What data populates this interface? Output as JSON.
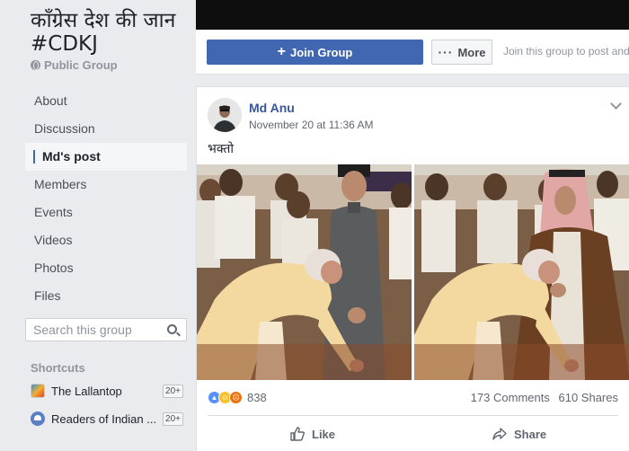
{
  "sidebar": {
    "group_name": "कॉंग्रेस देश की जान #CDKJ",
    "privacy": "Public Group",
    "nav": [
      "About",
      "Discussion",
      "Md's post",
      "Members",
      "Events",
      "Videos",
      "Photos",
      "Files"
    ],
    "active_nav": "Md's post",
    "search_placeholder": "Search this group",
    "shortcuts_title": "Shortcuts",
    "shortcuts": [
      {
        "label": "The Lallantop",
        "badge": "20+",
        "icon": "lallantop-avatar-icon"
      },
      {
        "label": "Readers of Indian ...",
        "badge": "20+",
        "icon": "group-people-icon"
      }
    ]
  },
  "header": {
    "join_label": "Join Group",
    "more_label": "More",
    "join_hint": "Join this group to post and c"
  },
  "post": {
    "author": "Md Anu",
    "timestamp": "November 20 at 11:36 AM",
    "text": "भक्तो",
    "reaction_count": "838",
    "reaction_icons": [
      "like-icon",
      "haha-icon",
      "angry-icon"
    ],
    "comments": "173 Comments",
    "shares": "610 Shares",
    "like_label": "Like",
    "share_label": "Share"
  },
  "colors": {
    "accent": "#4267b2",
    "link": "#365899",
    "page_bg": "#e9ebee"
  }
}
